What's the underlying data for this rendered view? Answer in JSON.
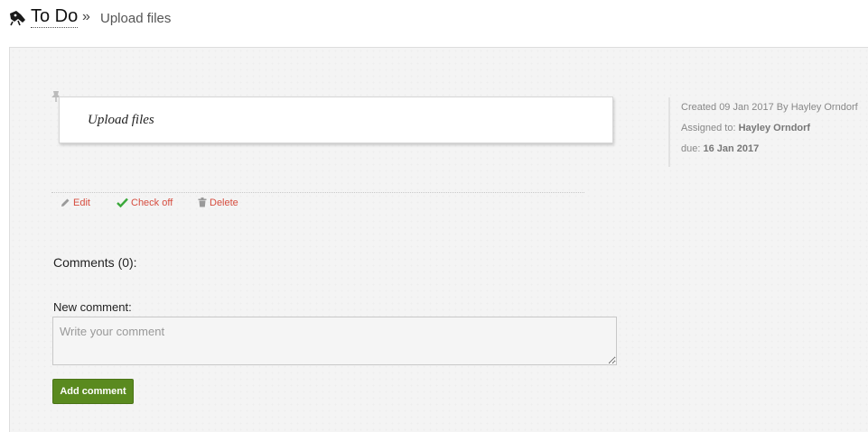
{
  "breadcrumb": {
    "root_label": "To Do",
    "separator": "»",
    "current_label": "Upload files"
  },
  "task": {
    "title": "Upload files"
  },
  "meta": {
    "created_text": "Created 09 Jan 2017 By Hayley Orndorf",
    "assigned_prefix": "Assigned to:",
    "assigned_name": "Hayley Orndorf",
    "due_prefix": "due:",
    "due_date": "16 Jan 2017"
  },
  "actions": {
    "edit_label": "Edit",
    "checkoff_label": "Check off",
    "delete_label": "Delete"
  },
  "comments": {
    "heading": "Comments (0):",
    "new_label": "New comment:",
    "placeholder": "Write your comment",
    "value": "",
    "submit_label": "Add comment"
  },
  "icons": {
    "app": "todo-app-icon",
    "pin": "pin-icon",
    "edit": "pencil-icon",
    "checkoff": "checkmark-icon",
    "delete": "trash-icon"
  },
  "colors": {
    "accent_link": "#d64d3f",
    "check_green": "#3aa83a",
    "button_green": "#5a8a1f",
    "panel_bg": "#f4f4f4"
  }
}
